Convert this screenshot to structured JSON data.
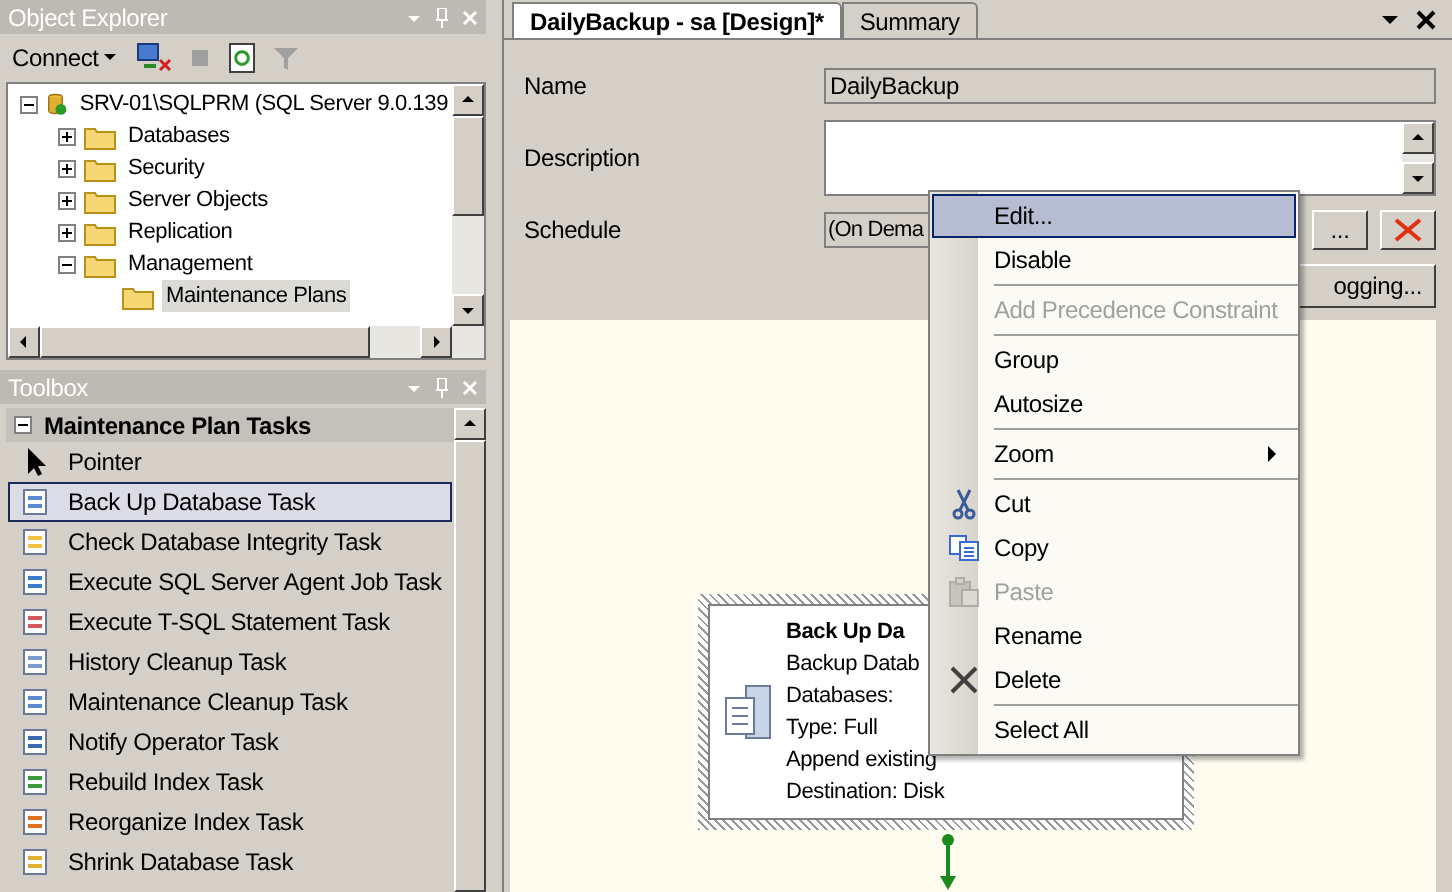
{
  "object_explorer": {
    "title": "Object Explorer",
    "connect_label": "Connect",
    "tree": [
      {
        "label": "SRV-01\\SQLPRM (SQL Server 9.0.139",
        "expanded": true,
        "selected": false,
        "children": [
          {
            "label": "Databases",
            "expanded": false,
            "selected": false
          },
          {
            "label": "Security",
            "expanded": false,
            "selected": false
          },
          {
            "label": "Server Objects",
            "expanded": false,
            "selected": false
          },
          {
            "label": "Replication",
            "expanded": false,
            "selected": false
          },
          {
            "label": "Management",
            "expanded": true,
            "selected": false,
            "children": [
              {
                "label": "Maintenance Plans",
                "selected": true
              }
            ]
          }
        ]
      }
    ]
  },
  "toolbox": {
    "title": "Toolbox",
    "group": {
      "label": "Maintenance Plan Tasks",
      "expanded": true
    },
    "items": [
      {
        "label": "Pointer",
        "selected": false
      },
      {
        "label": "Back Up Database Task",
        "selected": true
      },
      {
        "label": "Check Database Integrity Task",
        "selected": false
      },
      {
        "label": "Execute SQL Server Agent Job Task",
        "selected": false
      },
      {
        "label": "Execute T-SQL Statement Task",
        "selected": false
      },
      {
        "label": "History Cleanup Task",
        "selected": false
      },
      {
        "label": "Maintenance Cleanup Task",
        "selected": false
      },
      {
        "label": "Notify Operator Task",
        "selected": false
      },
      {
        "label": "Rebuild Index Task",
        "selected": false
      },
      {
        "label": "Reorganize Index Task",
        "selected": false
      },
      {
        "label": "Shrink Database Task",
        "selected": false
      }
    ]
  },
  "document": {
    "tabs": [
      {
        "label": "DailyBackup - sa [Design]*",
        "selected": true
      },
      {
        "label": "Summary",
        "selected": false
      }
    ],
    "name_label": "Name",
    "name_value": "DailyBackup",
    "description_label": "Description",
    "schedule_label": "Schedule",
    "schedule_value": "(On Dema",
    "browse_button": "...",
    "logging_button": "ogging...",
    "task": {
      "title": "Back Up Da",
      "lines": [
        "Backup Datab",
        "Databases:",
        "Type: Full",
        "Append existing",
        "Destination: Disk"
      ]
    }
  },
  "context_menu": {
    "items": [
      {
        "kind": "item",
        "label": "Edit...",
        "selected": true,
        "disabled": false
      },
      {
        "kind": "item",
        "label": "Disable",
        "selected": false,
        "disabled": false
      },
      {
        "kind": "separator"
      },
      {
        "kind": "item",
        "label": "Add Precedence Constraint",
        "selected": false,
        "disabled": true
      },
      {
        "kind": "separator"
      },
      {
        "kind": "item",
        "label": "Group",
        "selected": false,
        "disabled": false
      },
      {
        "kind": "item",
        "label": "Autosize",
        "selected": false,
        "disabled": false
      },
      {
        "kind": "separator"
      },
      {
        "kind": "submenu",
        "label": "Zoom",
        "selected": false,
        "disabled": false
      },
      {
        "kind": "separator"
      },
      {
        "kind": "item",
        "label": "Cut",
        "selected": false,
        "disabled": false
      },
      {
        "kind": "item",
        "label": "Copy",
        "selected": false,
        "disabled": false
      },
      {
        "kind": "item",
        "label": "Paste",
        "selected": false,
        "disabled": true
      },
      {
        "kind": "item",
        "label": "Rename",
        "selected": false,
        "disabled": false
      },
      {
        "kind": "item",
        "label": "Delete",
        "selected": false,
        "disabled": false
      },
      {
        "kind": "separator"
      },
      {
        "kind": "item",
        "label": "Select All",
        "selected": false,
        "disabled": false
      }
    ]
  }
}
